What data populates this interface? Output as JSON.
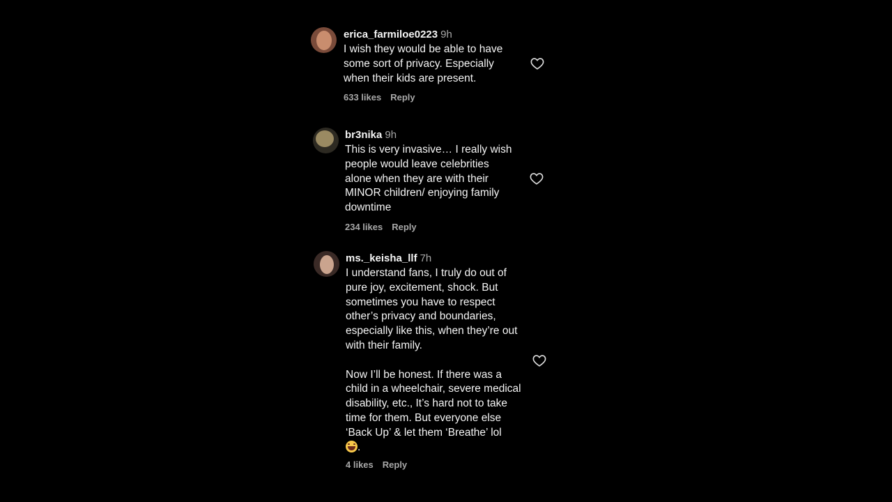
{
  "comments": [
    {
      "username": "erica_farmiloe0223",
      "time": "9h",
      "text": "I wish they would be able to have\nsome sort of privacy. Especially\nwhen their kids are present.",
      "text_after_emoji": "",
      "likes": "633 likes",
      "reply": "Reply",
      "avatar_colors": [
        "#c98d6e",
        "#7a4b3a"
      ]
    },
    {
      "username": "br3nika",
      "time": "9h",
      "text": "This is very invasive… I really wish\npeople would leave celebrities\nalone when they are with their\nMINOR children/ enjoying family\ndowntime",
      "text_after_emoji": "",
      "likes": "234 likes",
      "reply": "Reply",
      "avatar_colors": [
        "#9a8a62",
        "#2d2a22"
      ]
    },
    {
      "username": "ms._keisha_llf",
      "time": "7h",
      "text": "I understand fans, I truly do out of\npure joy, excitement, shock. But\nsometimes you have to respect\nother’s privacy and boundaries,\nespecially like this, when they’re out\nwith their family.\n\nNow I’ll be honest. If there was a\nchild in a wheelchair, severe medical\ndisability, etc., It’s hard not to take\ntime for them. But everyone else\n‘Back Up’ & let them ‘Breathe’ lol\n",
      "text_after_emoji": ".",
      "likes": "4 likes",
      "reply": "Reply",
      "avatar_colors": [
        "#caa48e",
        "#3a2a26"
      ]
    }
  ],
  "icons": {
    "like": "heart-outline-icon",
    "emoji": "laughing-emoji-icon"
  },
  "colors": {
    "background": "#000000",
    "text_primary": "#f5f5f5",
    "text_secondary": "#a8a8a8"
  }
}
